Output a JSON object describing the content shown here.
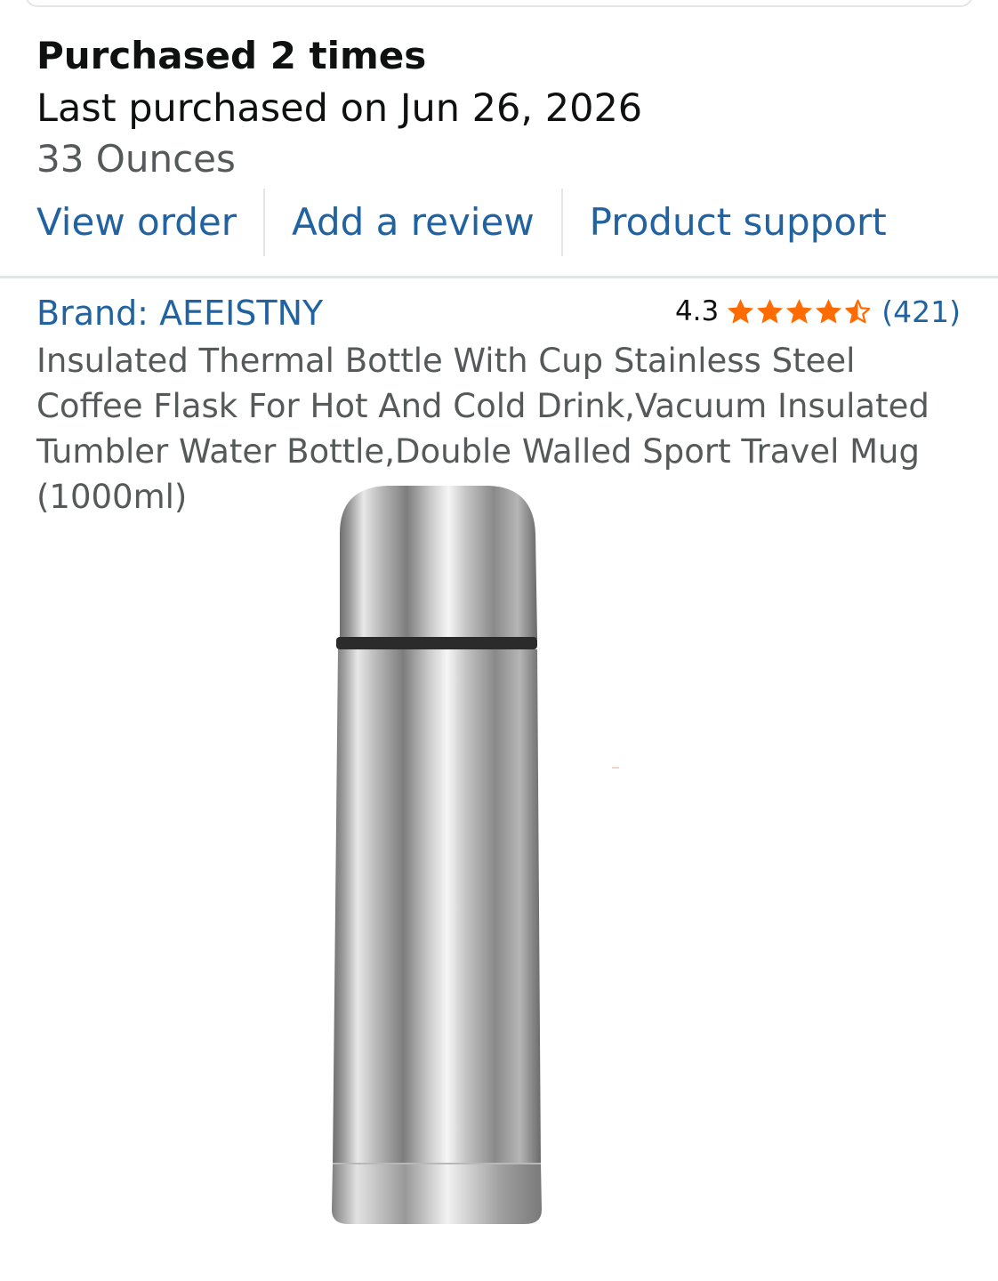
{
  "purchase": {
    "count_text": "Purchased 2 times",
    "last_purchased": "Last purchased on Jun 26, 2026",
    "size": "33 Ounces"
  },
  "actions": {
    "view_order": "View order",
    "add_review": "Add a review",
    "product_support": "Product support"
  },
  "product": {
    "brand": "Brand: AEEISTNY",
    "rating": "4.3",
    "rating_value": 4.3,
    "rating_max": 5,
    "review_count": "(421)",
    "title": "Insulated Thermal Bottle With Cup Stainless Steel Coffee Flask For Hot And Cold Drink,Vacuum Insulated Tumbler Water Bottle,Double Walled Sport Travel Mug (1000ml)",
    "image_icon": "thermos-bottle-image"
  },
  "colors": {
    "link": "#2162a1",
    "text": "#0f1111",
    "secondary_text": "#565959",
    "star": "#ff6b00",
    "divider": "#e3e6e6"
  }
}
